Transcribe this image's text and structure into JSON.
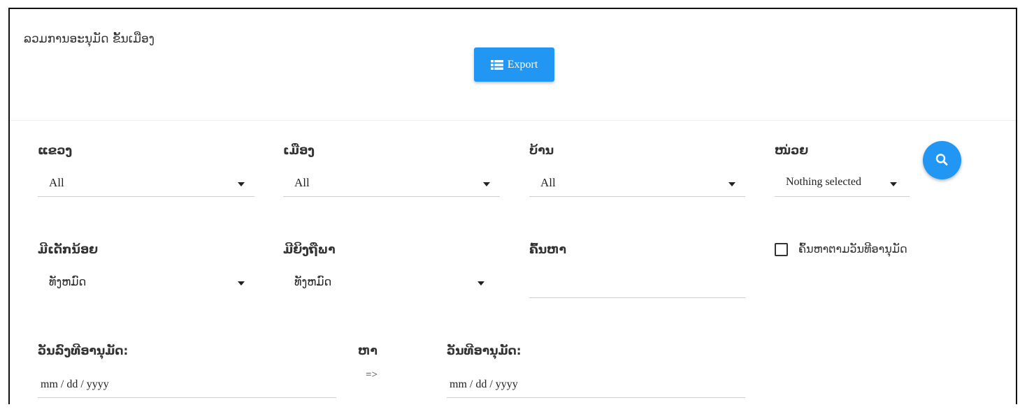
{
  "header": {
    "title": "ລວມການອະນຸມັດ ຂັ້ນເມືອງ",
    "export_label": "Export"
  },
  "filters": {
    "province": {
      "label": "ແຂວງ",
      "value": "All"
    },
    "district": {
      "label": "ເມືອງ",
      "value": "All"
    },
    "village": {
      "label": "ບ້ານ",
      "value": "All"
    },
    "unit": {
      "label": "ໜ່ວຍ",
      "value": "Nothing selected"
    },
    "has_children": {
      "label": "ມີເດັກນ້ອຍ",
      "value": "ທັງຫມົດ"
    },
    "pregnant": {
      "label": "ມີຍິງຖືພາ",
      "value": "ທັງຫມົດ"
    },
    "search": {
      "label": "ຄົ້ນຫາ",
      "value": ""
    },
    "search_by_date": {
      "label": "ຄົ້ນຫາຕາມວັນທີອານຸມັດ",
      "checked": false
    }
  },
  "dates": {
    "start_label": "ວັນລົງທີອານຸມັດ:",
    "to_label": "ຫາ",
    "arrow": "=>",
    "end_label": "ວັນທີອານຸມັດ:",
    "start_placeholder": "mm / dd / yyyy",
    "end_placeholder": "mm / dd / yyyy"
  },
  "colors": {
    "accent": "#2196f3"
  },
  "icons": {
    "export": "list-icon",
    "search": "search-icon",
    "dropdown": "caret-down-icon"
  }
}
